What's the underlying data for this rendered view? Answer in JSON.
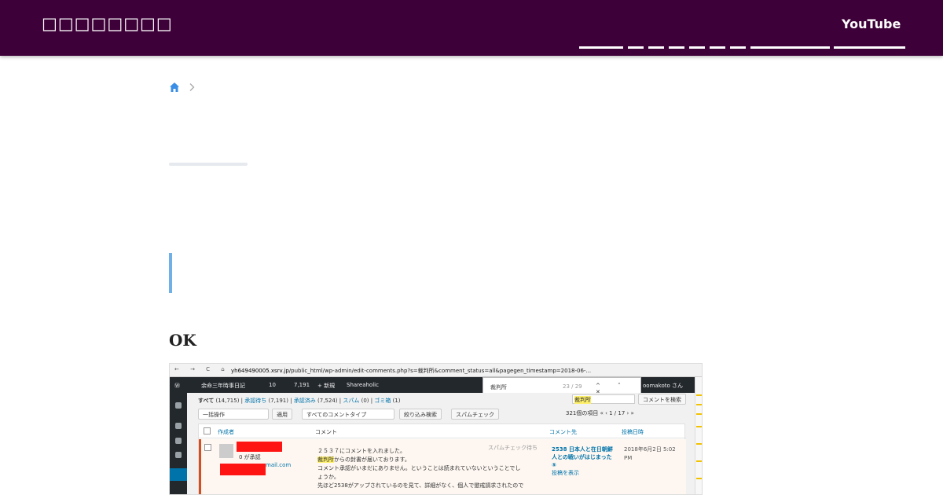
{
  "header": {
    "site_title": "□□□□□□□□",
    "youtube_label": "YouTube"
  },
  "breadcrumb": {
    "home_icon": "home-icon",
    "separator_icon": "chevron-right-icon"
  },
  "article": {
    "heading": "OK"
  },
  "screenshot": {
    "browser_nav": "← → C ⌂",
    "url_host": "yh649490005.xsrv.jp",
    "url_path": "/public_html/wp-admin/edit-comments.php?s=裁判所&comment_status=all&pagegen_timestamp=2018-06-...",
    "admin_bar": {
      "site": "余命三年時事日記",
      "comments": "10",
      "updates": "7,191",
      "new": "+ 新規",
      "plugin": "Shareaholic",
      "user": "oomakoto さん"
    },
    "find_bar": {
      "query": "裁判所",
      "count": "23 / 29",
      "controls": "^ ˅ ✕"
    },
    "filters": {
      "all": "すべて",
      "all_count": "(14,715)",
      "pending": "承認待ち",
      "pending_count": "(7,191)",
      "approved": "承認済み",
      "approved_count": "(7,524)",
      "spam": "スパム",
      "spam_count": "(0)",
      "trash": "ゴミ箱",
      "trash_count": "(1)"
    },
    "search_value": "裁判所",
    "search_button": "コメントを検索",
    "bulk_action": "一括操作",
    "apply_button": "適用",
    "type_filter": "すべてのコメントタイプ",
    "filter_button": "絞り込み検索",
    "spam_check_button": "スパムチェック",
    "pagination": "321個の項目   «  ‹   1   / 17  ›  »",
    "columns": {
      "author": "作成者",
      "comment": "コメント",
      "in_response": "コメント先",
      "submitted": "投稿日時"
    },
    "row": {
      "approved_label": "0 が承認",
      "email_fragment": "mail.com",
      "line1": "２５３７にコメントを入れました。",
      "highlight": "裁判所",
      "line2": "からの封書が届いております。",
      "line3": "コメント承認がいまだにありません。ということは読まれていないということでし",
      "line4": "ょうか。",
      "line5": "先ほど2538がアップされているのを見て、詳細がなく、個人で懲戒請求されたので",
      "status": "スパムチェック待ち",
      "post_title": "2538 日本人と在日朝鮮人との戦いがはじまった",
      "post_suffix": "⑤",
      "view_post": "投稿を表示",
      "date": "2018年6月2日 5:02 PM"
    }
  }
}
